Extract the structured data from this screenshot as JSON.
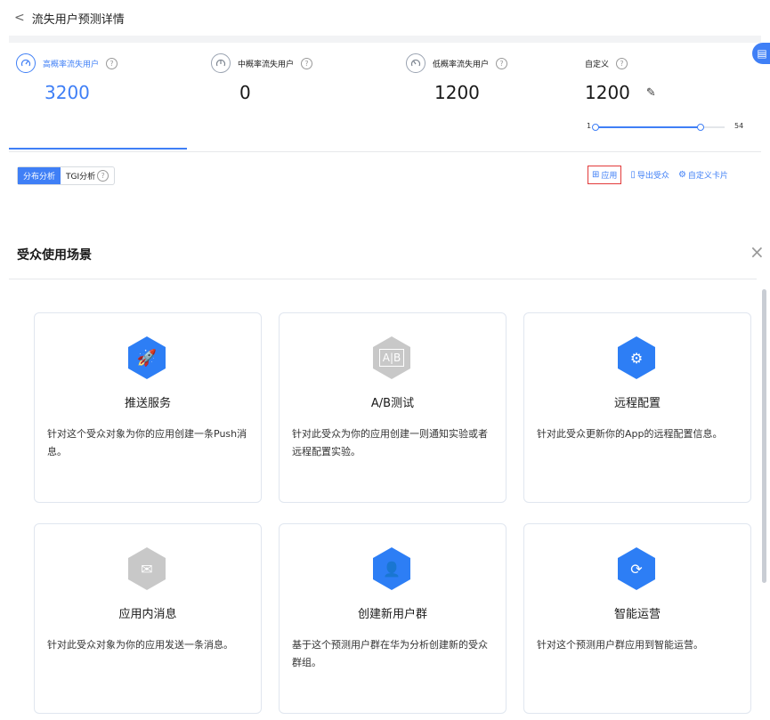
{
  "header": {
    "back_glyph": "<",
    "title": "流失用户预测详情"
  },
  "stats": [
    {
      "label": "高概率流失用户",
      "value": "3200",
      "active": true
    },
    {
      "label": "中概率流失用户",
      "value": "0",
      "active": false
    },
    {
      "label": "低概率流失用户",
      "value": "1200",
      "active": false
    },
    {
      "label": "自定义",
      "value": "1200",
      "active": false
    }
  ],
  "slider": {
    "min_label": "1",
    "max_label": "54",
    "min": 1,
    "max": 54,
    "low": 1,
    "high": 44
  },
  "tabs": [
    {
      "label": "分布分析"
    },
    {
      "label": "TGI分析"
    }
  ],
  "actions": [
    {
      "label": "应用",
      "icon": "grid-icon"
    },
    {
      "label": "导出受众",
      "icon": "export-icon"
    },
    {
      "label": "自定义卡片",
      "icon": "settings-icon"
    }
  ],
  "section": {
    "title": "受众使用场景",
    "close": "×"
  },
  "cards": [
    {
      "title": "推送服务",
      "desc": "针对这个受众对象为你的应用创建一条Push消息。",
      "icon": "rocket-icon",
      "color": "#2d7ef5"
    },
    {
      "title": "A/B测试",
      "desc": "针对此受众为你的应用创建一则通知实验或者远程配置实验。",
      "icon": "ab-test-icon",
      "color": "#c8c8c8"
    },
    {
      "title": "远程配置",
      "desc": "针对此受众更新你的App的远程配置信息。",
      "icon": "remote-config-icon",
      "color": "#2d7ef5"
    },
    {
      "title": "应用内消息",
      "desc": "针对此受众对象为你的应用发送一条消息。",
      "icon": "in-app-message-icon",
      "color": "#c8c8c8"
    },
    {
      "title": "创建新用户群",
      "desc": "基于这个预测用户群在华为分析创建新的受众群组。",
      "icon": "add-user-group-icon",
      "color": "#2d7ef5"
    },
    {
      "title": "智能运营",
      "desc": "针对这个预测用户群应用到智能运营。",
      "icon": "smart-operation-icon",
      "color": "#2d7ef5"
    }
  ]
}
